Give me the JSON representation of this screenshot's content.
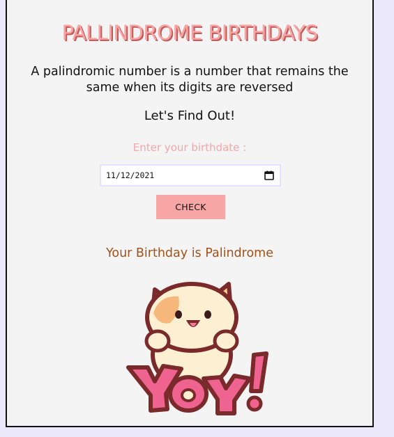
{
  "app": {
    "title": "PALLINDROME BIRTHDAYS",
    "description": "A palindromic number is a number that remains the same when its digits are reversed",
    "tagline": "Let's Find Out!"
  },
  "form": {
    "prompt_label": "Enter your birthdate :",
    "date_value": "11/12/2021",
    "check_label": "CHECK"
  },
  "result": {
    "message": "Your Birthday is Palindrome"
  },
  "image": {
    "description_icon": "yay-cat-icon"
  },
  "colors": {
    "background": "#ece9fd",
    "card": "#f4f4f4",
    "title": "#f7a3a3",
    "button": "#f8a5a5",
    "result_text": "#a1521b"
  }
}
